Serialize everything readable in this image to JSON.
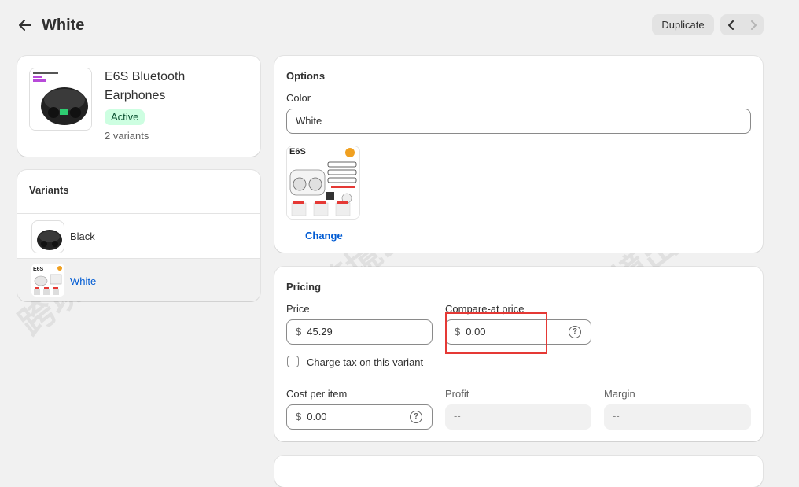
{
  "header": {
    "back_icon": "arrow-left-icon",
    "title": "White",
    "duplicate_label": "Duplicate",
    "prev_icon": "chevron-left-icon",
    "next_icon": "chevron-right-icon"
  },
  "product": {
    "name_line1": "E6S Bluetooth",
    "name_line2": "Earphones",
    "status": "Active",
    "variant_count": "2 variants"
  },
  "variants": {
    "heading": "Variants",
    "items": [
      {
        "label": "Black",
        "selected": false
      },
      {
        "label": "White",
        "selected": true
      }
    ]
  },
  "options": {
    "heading": "Options",
    "color_label": "Color",
    "color_value": "White",
    "image_brand": "E6S",
    "change_label": "Change"
  },
  "pricing": {
    "heading": "Pricing",
    "price_label": "Price",
    "price_currency": "$",
    "price_value": "45.29",
    "compare_label": "Compare-at price",
    "compare_currency": "$",
    "compare_value": "0.00",
    "tax_label": "Charge tax on this variant",
    "cost_label": "Cost per item",
    "cost_currency": "$",
    "cost_value": "0.00",
    "profit_label": "Profit",
    "profit_value": "--",
    "margin_label": "Margin",
    "margin_value": "--"
  },
  "watermark": "跨境出海陆路",
  "colors": {
    "accent_link": "#005bd3",
    "active_badge_bg": "#cdfee1",
    "highlight_border": "#e53935"
  }
}
